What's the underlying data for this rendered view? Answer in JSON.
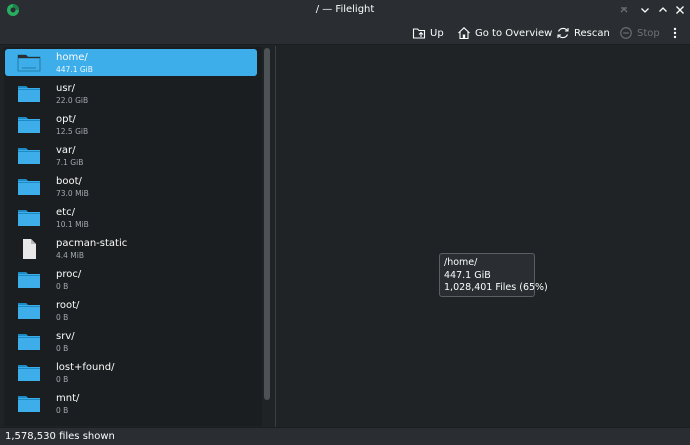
{
  "window": {
    "title": "/ — Filelight"
  },
  "toolbar": {
    "up_label": "Up",
    "overview_label": "Go to Overview",
    "rescan_label": "Rescan",
    "stop_label": "Stop"
  },
  "sidebar": {
    "items": [
      {
        "name": "home/",
        "size": "447.1 GiB",
        "icon": "folder-icon"
      },
      {
        "name": "usr/",
        "size": "22.0 GiB",
        "icon": "folder-icon"
      },
      {
        "name": "opt/",
        "size": "12.5 GiB",
        "icon": "folder-icon"
      },
      {
        "name": "var/",
        "size": "7.1 GiB",
        "icon": "folder-icon"
      },
      {
        "name": "boot/",
        "size": "73.0 MiB",
        "icon": "folder-icon"
      },
      {
        "name": "etc/",
        "size": "10.1 MiB",
        "icon": "folder-icon"
      },
      {
        "name": "pacman-static",
        "size": "4.4 MiB",
        "icon": "file-icon"
      },
      {
        "name": "proc/",
        "size": "0 B",
        "icon": "folder-icon"
      },
      {
        "name": "root/",
        "size": "0 B",
        "icon": "folder-icon"
      },
      {
        "name": "srv/",
        "size": "0 B",
        "icon": "folder-icon"
      },
      {
        "name": "lost+found/",
        "size": "0 B",
        "icon": "folder-icon"
      },
      {
        "name": "mnt/",
        "size": "0 B",
        "icon": "folder-icon"
      }
    ]
  },
  "tooltip": {
    "path": "/home/",
    "size": "447.1 GiB",
    "files": "1,028,401 Files (65%)"
  },
  "status": {
    "text": "1,578,530 files shown"
  },
  "colors": {
    "accent": "#3daee9",
    "background": "#202326",
    "surface": "#2a2e32",
    "list_background": "#1b1e20"
  }
}
